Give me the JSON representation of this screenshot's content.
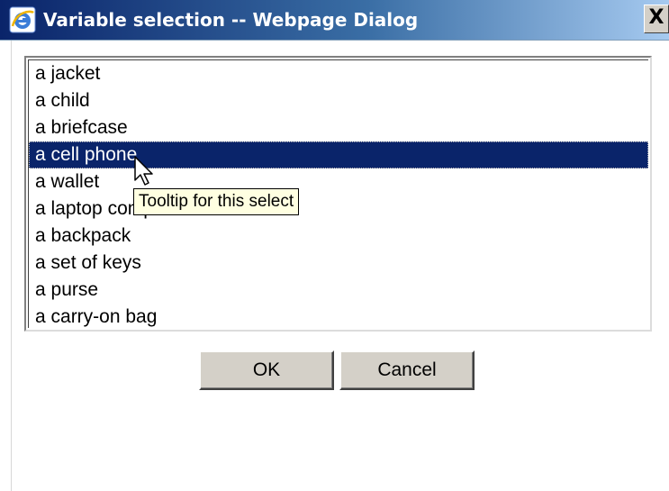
{
  "window": {
    "title": "Variable selection -- Webpage Dialog",
    "close_label": "X",
    "icon": "internet-explorer-icon"
  },
  "listbox": {
    "items": [
      {
        "label": "a jacket",
        "selected": false
      },
      {
        "label": "a child",
        "selected": false
      },
      {
        "label": "a briefcase",
        "selected": false
      },
      {
        "label": "a cell phone",
        "selected": true
      },
      {
        "label": "a wallet",
        "selected": false
      },
      {
        "label": "a laptop computer",
        "selected": false
      },
      {
        "label": "a backpack",
        "selected": false
      },
      {
        "label": "a set of keys",
        "selected": false
      },
      {
        "label": "a purse",
        "selected": false
      },
      {
        "label": "a carry-on bag",
        "selected": false
      }
    ],
    "tooltip": "Tooltip for this select"
  },
  "buttons": {
    "ok_label": "OK",
    "cancel_label": "Cancel"
  },
  "colors": {
    "title_bar": "#0a246a",
    "selection": "#0a246a",
    "button_face": "#d4d0c8",
    "tooltip_bg": "#ffffe1"
  }
}
